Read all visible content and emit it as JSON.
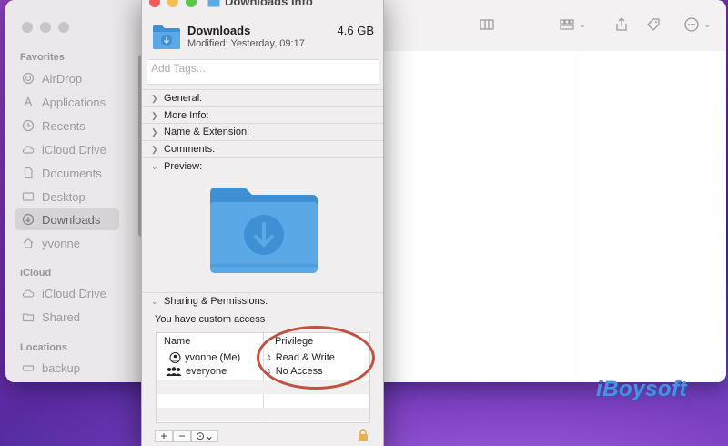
{
  "finder": {
    "sidebar": {
      "sections": [
        {
          "label": "Favorites",
          "items": [
            {
              "label": "AirDrop",
              "icon": "airdrop-icon"
            },
            {
              "label": "Applications",
              "icon": "applications-icon"
            },
            {
              "label": "Recents",
              "icon": "clock-icon"
            },
            {
              "label": "iCloud Drive",
              "icon": "cloud-icon"
            },
            {
              "label": "Documents",
              "icon": "document-icon"
            },
            {
              "label": "Desktop",
              "icon": "desktop-icon"
            },
            {
              "label": "Downloads",
              "icon": "download-circle-icon",
              "active": true
            },
            {
              "label": "yvonne",
              "icon": "home-icon"
            }
          ]
        },
        {
          "label": "iCloud",
          "items": [
            {
              "label": "iCloud Drive",
              "icon": "cloud-icon"
            },
            {
              "label": "Shared",
              "icon": "shared-folder-icon"
            }
          ]
        },
        {
          "label": "Locations",
          "items": [
            {
              "label": "backup",
              "icon": "drive-icon"
            }
          ]
        }
      ]
    }
  },
  "info": {
    "title": "Downloads Info",
    "name": "Downloads",
    "size": "4.6 GB",
    "modified": "Modified: Yesterday, 09:17",
    "tags_placeholder": "Add Tags...",
    "sections": [
      "General:",
      "More Info:",
      "Name & Extension:",
      "Comments:",
      "Preview:"
    ],
    "sharing_section": "Sharing & Permissions:",
    "access_text": "You have custom access",
    "permissions": {
      "headers": {
        "name": "Name",
        "privilege": "Privilege"
      },
      "rows": [
        {
          "name": "yvonne (Me)",
          "privilege": "Read & Write",
          "icon": "user-icon"
        },
        {
          "name": "everyone",
          "privilege": "No Access",
          "icon": "group-icon"
        }
      ]
    },
    "buttons": {
      "add": "+",
      "remove": "−",
      "actions": "⊙⌄"
    }
  },
  "watermark": "iBoysoft",
  "colors": {
    "folder_blue": "#5aa8e6",
    "folder_dark": "#3f8fd4",
    "annotation": "#c05242"
  }
}
